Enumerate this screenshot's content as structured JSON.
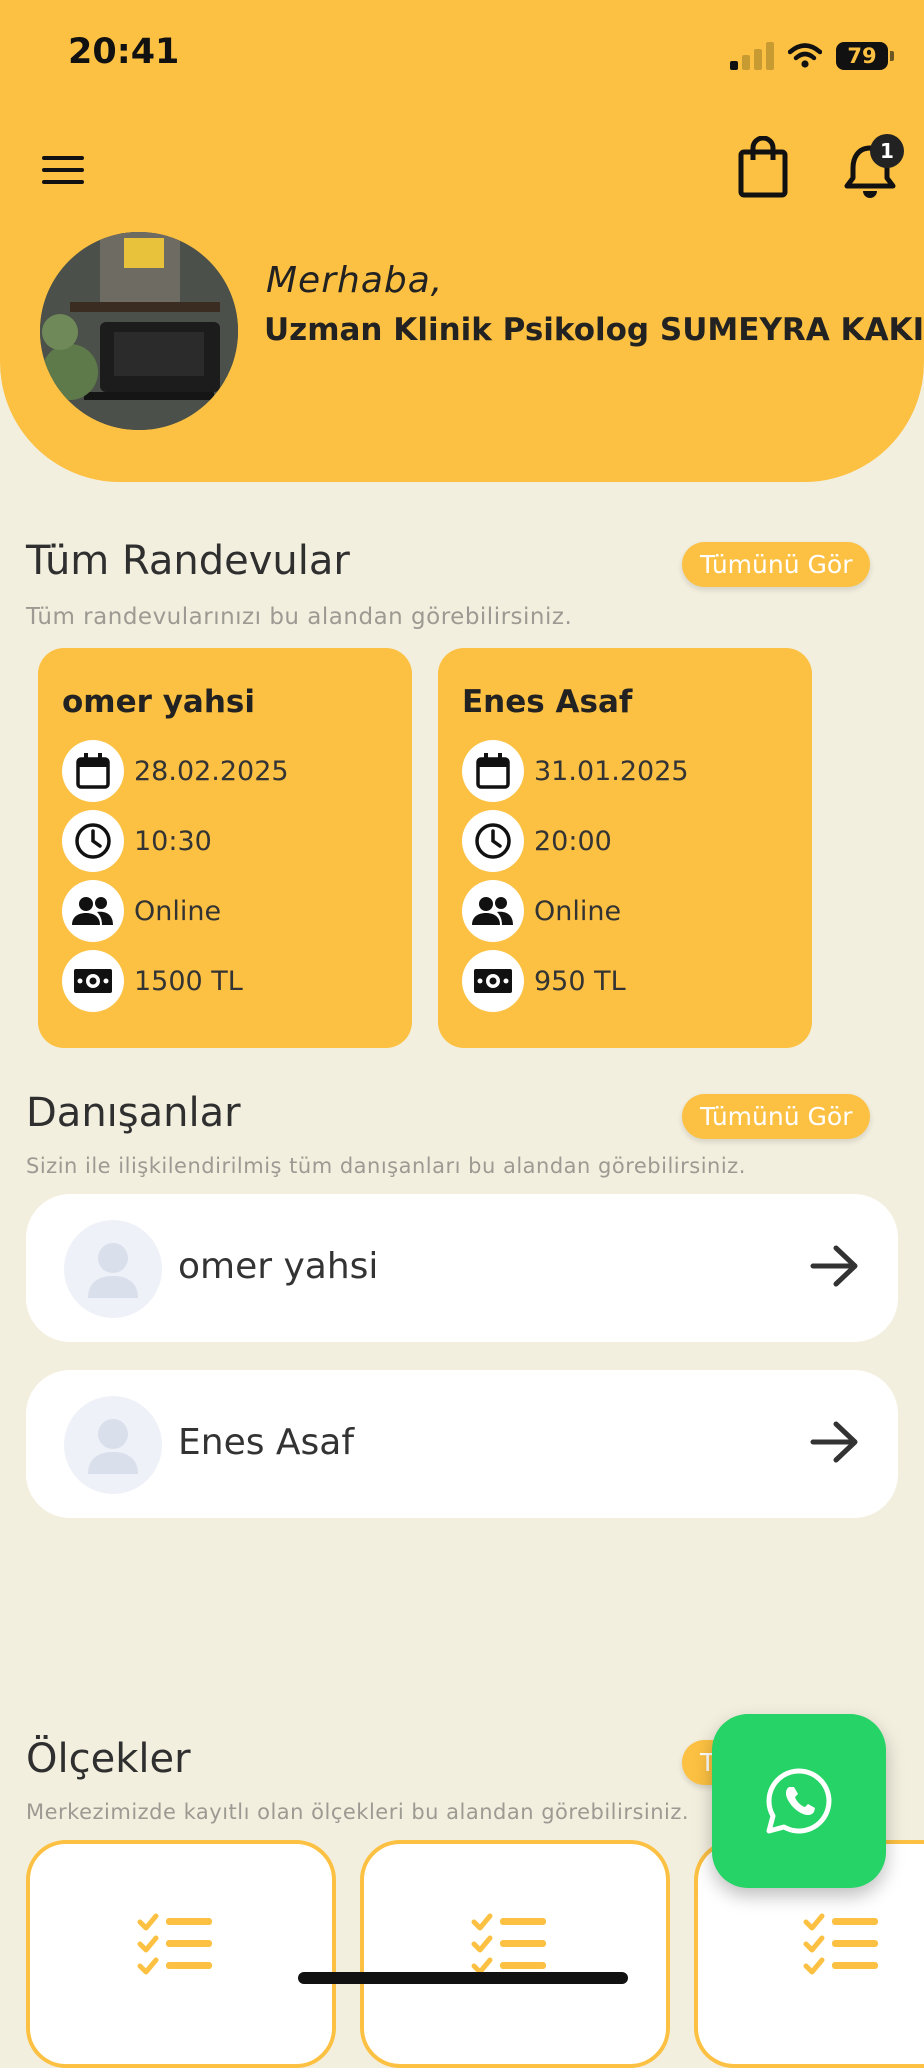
{
  "status_bar": {
    "time": "20:41",
    "battery": "79"
  },
  "header": {
    "greeting": "Merhaba,",
    "user_name": "Uzman Klinik Psikolog SUMEYRA KAKIZ!",
    "notification_count": "1",
    "icons": [
      "menu-icon",
      "shopping-bag-icon",
      "bell-icon"
    ]
  },
  "appointments": {
    "title": "Tüm Randevular",
    "subtitle": "Tüm randevularınızı bu alandan görebilirsiniz.",
    "see_all": "Tümünü Gör",
    "items": [
      {
        "name": "omer yahsi",
        "date": "28.02.2025",
        "time": "10:30",
        "type": "Online",
        "price": "1500 TL"
      },
      {
        "name": "Enes Asaf",
        "date": "31.01.2025",
        "time": "20:00",
        "type": "Online",
        "price": "950 TL"
      }
    ]
  },
  "clients": {
    "title": "Danışanlar",
    "subtitle": "Sizin ile ilişkilendirilmiş tüm danışanları bu alandan görebilirsiniz.",
    "see_all": "Tümünü Gör",
    "items": [
      {
        "name": "omer yahsi"
      },
      {
        "name": "Enes Asaf"
      }
    ]
  },
  "scales": {
    "title": "Ölçekler",
    "subtitle": "Merkezimizde kayıtlı olan ölçekleri bu alandan görebilirsiniz.",
    "see_all": "T"
  },
  "colors": {
    "accent": "#fcc142",
    "background": "#f3efdf",
    "whatsapp": "#25d366"
  }
}
